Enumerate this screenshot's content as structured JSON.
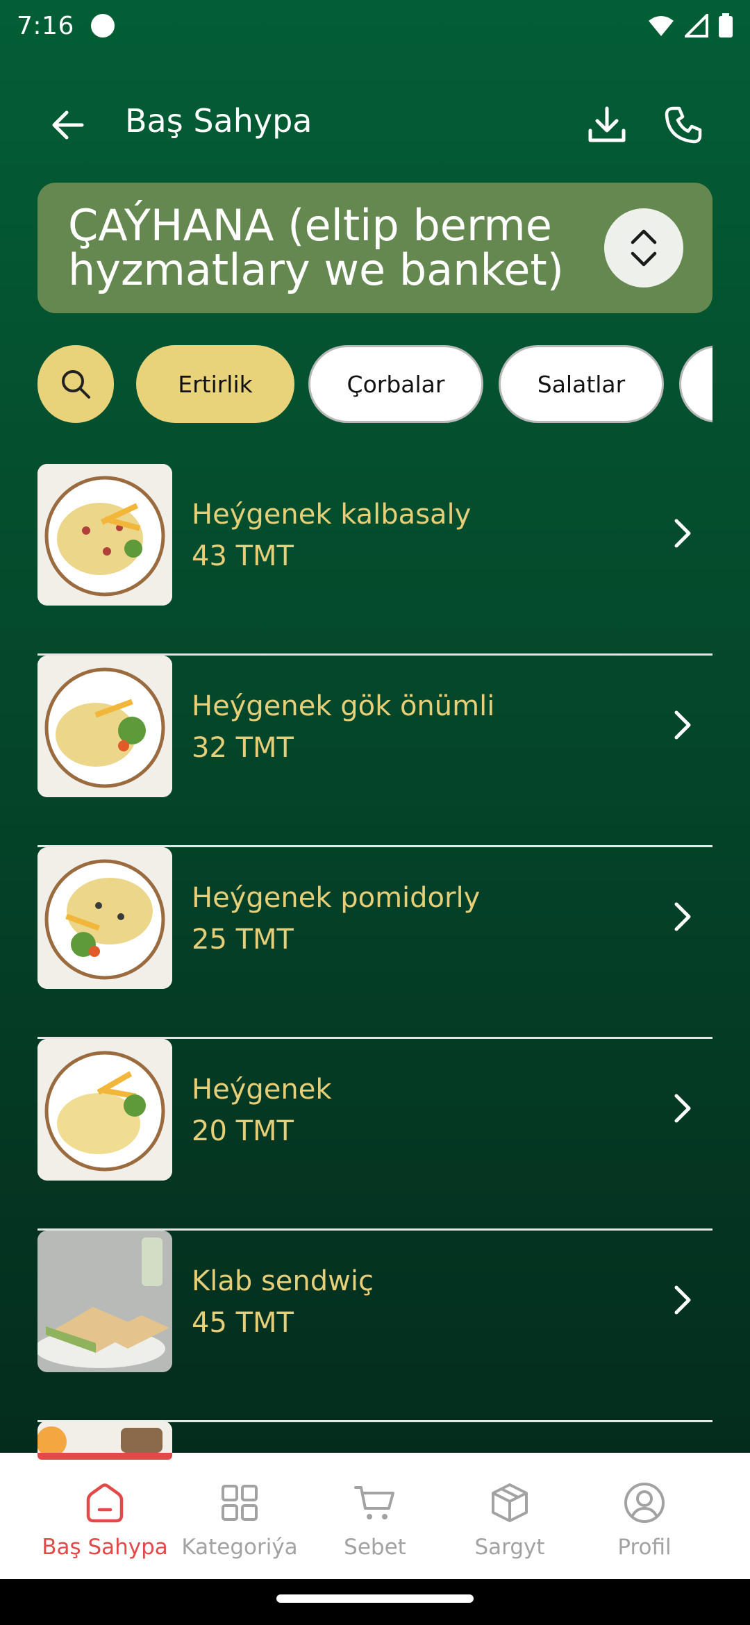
{
  "status_bar": {
    "time": "7:16"
  },
  "header": {
    "title": "Baş Sahypa",
    "back_icon": "arrow-left-icon",
    "download_icon": "download-icon",
    "phone_icon": "phone-icon"
  },
  "restaurant": {
    "name": "ÇAÝHANA (eltip berme hyzmatlary we banket)",
    "card_color": "#64884f"
  },
  "categories": {
    "chips": [
      "Ertirlik",
      "Çorbalar",
      "Salatlar"
    ],
    "active": "Ertirlik",
    "accent_color": "#e8d27a"
  },
  "menu": {
    "items": [
      {
        "name": "Heýgenek kalbasaly",
        "price": "43 TMT"
      },
      {
        "name": "Heýgenek gök önümli",
        "price": "32 TMT"
      },
      {
        "name": "Heýgenek pomidorly",
        "price": "25 TMT"
      },
      {
        "name": "Heýgenek",
        "price": "20 TMT"
      },
      {
        "name": "Klab sendwiç",
        "price": "45 TMT"
      }
    ],
    "text_color": "#e6cf78"
  },
  "bottom_nav": {
    "items": [
      {
        "label": "Baş Sahypa",
        "icon": "home-icon",
        "active": true
      },
      {
        "label": "Kategoriýa",
        "icon": "grid-icon",
        "active": false
      },
      {
        "label": "Sebet",
        "icon": "cart-icon",
        "active": false
      },
      {
        "label": "Sargyt",
        "icon": "package-icon",
        "active": false
      },
      {
        "label": "Profil",
        "icon": "profile-icon",
        "active": false
      }
    ],
    "active_color": "#e24a4a",
    "inactive_color": "#a2a2a2"
  }
}
